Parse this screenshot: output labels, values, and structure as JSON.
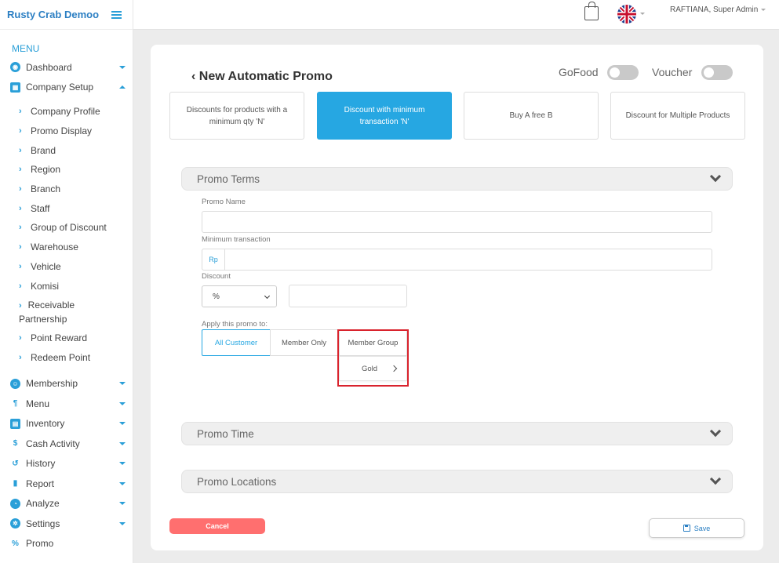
{
  "sidebar": {
    "brand": "Rusty Crab Demoo",
    "menu_title": "MENU",
    "top_items": [
      {
        "label": "Dashboard",
        "icon": "dashboard-icon"
      },
      {
        "label": "Company Setup",
        "icon": "building-icon"
      }
    ],
    "sub_items": [
      {
        "label": "Company Profile"
      },
      {
        "label": "Promo Display"
      },
      {
        "label": "Brand"
      },
      {
        "label": "Region"
      },
      {
        "label": "Branch"
      },
      {
        "label": "Staff"
      },
      {
        "label": "Group of Discount"
      },
      {
        "label": "Warehouse"
      },
      {
        "label": "Vehicle"
      },
      {
        "label": "Komisi"
      },
      {
        "label": "Receivable",
        "label2": "Partnership"
      },
      {
        "label": "Point Reward"
      },
      {
        "label": "Redeem Point"
      }
    ],
    "bottom_items": [
      {
        "label": "Membership",
        "icon": "users-icon",
        "glyph": "☺"
      },
      {
        "label": "Menu",
        "icon": "cutlery-icon",
        "glyph": "¶"
      },
      {
        "label": "Inventory",
        "icon": "inventory-icon",
        "glyph": "▤"
      },
      {
        "label": "Cash Activity",
        "icon": "dollar-icon",
        "glyph": "$"
      },
      {
        "label": "History",
        "icon": "history-icon",
        "glyph": "↺"
      },
      {
        "label": "Report",
        "icon": "report-icon",
        "glyph": "▮"
      },
      {
        "label": "Analyze",
        "icon": "pie-chart-icon",
        "glyph": "◔"
      },
      {
        "label": "Settings",
        "icon": "gear-icon",
        "glyph": "✲"
      },
      {
        "label": "Promo",
        "icon": "percent-icon",
        "glyph": "%"
      }
    ]
  },
  "topbar": {
    "user": "RAFTIANA, Super Admin"
  },
  "page": {
    "title": "New Automatic Promo",
    "toggles": [
      {
        "label": "GoFood",
        "on": false
      },
      {
        "label": "Voucher",
        "on": false
      }
    ],
    "promo_types": [
      {
        "label": "Discounts for products with a minimum qty 'N'",
        "active": false
      },
      {
        "label": "Discount with minimum transaction 'N'",
        "active": true
      },
      {
        "label": "Buy A free B",
        "active": false
      },
      {
        "label": "Discount for Multiple Products",
        "active": false
      }
    ],
    "terms": {
      "header": "Promo Terms",
      "promo_name_label": "Promo Name",
      "promo_name_value": "",
      "min_trans_label": "Minimum transaction",
      "currency": "Rp",
      "min_trans_value": "",
      "discount_label": "Discount",
      "discount_type": "%",
      "discount_value": "",
      "apply_label": "Apply this promo to:",
      "apply_options": [
        "All Customer",
        "Member Only",
        "Member Group"
      ],
      "apply_selected": "All Customer",
      "group_item": "Gold"
    },
    "time_header": "Promo Time",
    "locations_header": "Promo Locations",
    "cancel_label": "Cancel",
    "save_label": "Save"
  },
  "colors": {
    "accent": "#26a7e2",
    "cancel": "#ff6f6f",
    "highlight": "#d9232d"
  }
}
